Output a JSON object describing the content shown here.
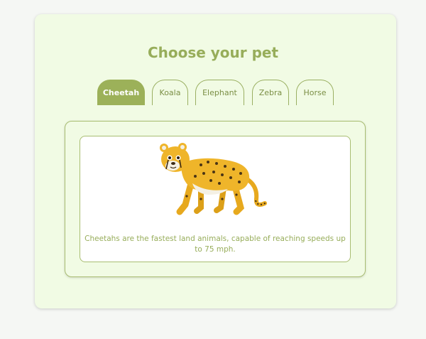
{
  "page": {
    "title": "Choose your pet"
  },
  "tabs": [
    {
      "label": "Cheetah",
      "active": true
    },
    {
      "label": "Koala",
      "active": false
    },
    {
      "label": "Elephant",
      "active": false
    },
    {
      "label": "Zebra",
      "active": false
    },
    {
      "label": "Horse",
      "active": false
    }
  ],
  "selected_pet": {
    "description": "Cheetahs are the fastest land animals, capable of reaching speeds up to 75 mph."
  },
  "colors": {
    "accent": "#9cb159",
    "card_background": "#f1fbe4",
    "text": "#97ad5a"
  },
  "icons": {
    "pet_image": "cheetah-illustration"
  }
}
